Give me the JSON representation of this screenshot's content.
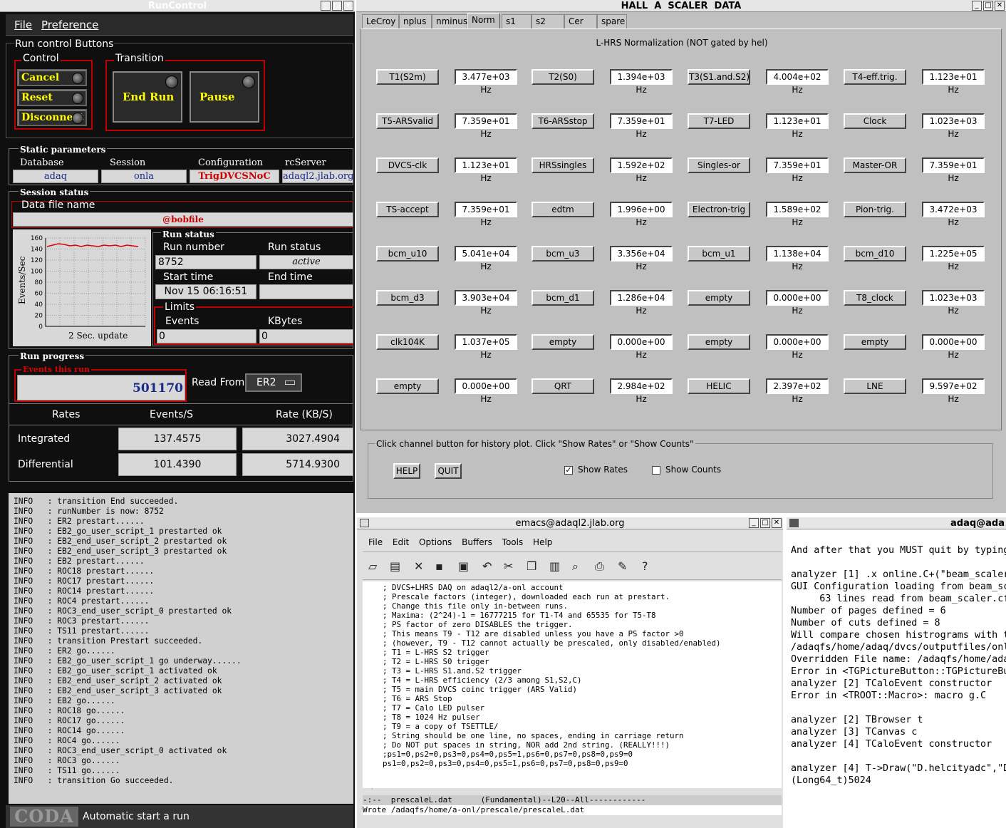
{
  "runcontrol": {
    "title": "RunControl",
    "menu": [
      "File",
      "Preference"
    ],
    "run_control_buttons": "Run control Buttons",
    "control_label": "Control",
    "control_buttons": [
      "Cancel",
      "Reset",
      "Disconnect"
    ],
    "transition_label": "Transition",
    "transition_buttons": [
      "End Run",
      "Pause"
    ],
    "static_parameters": "Static parameters",
    "static_headers": [
      "Database",
      "Session",
      "Configuration",
      "rcServer"
    ],
    "static_values": [
      "adaq",
      "onla",
      "TrigDVCSNoC",
      "adaql2.jlab.org"
    ],
    "session_status": "Session status",
    "data_file_name_label": "Data file name",
    "data_file_name": "@bobfile",
    "plot": {
      "ylabel": "Events/Sec",
      "xlabel": "2 Sec. update",
      "yticks": [
        "160",
        "140",
        "120",
        "100",
        "80",
        "60",
        "40",
        "20",
        "0"
      ]
    },
    "run_status_title": "Run status",
    "run_number_label": "Run number",
    "run_number": "8752",
    "run_status_label": "Run status",
    "run_status": "active",
    "start_time_label": "Start time",
    "start_time": "Nov 15 06:16:51",
    "end_time_label": "End time",
    "end_time": "",
    "limits_label": "Limits",
    "events_label": "Events",
    "events_limit": "0",
    "kbytes_label": "KBytes",
    "kbytes_limit": "0",
    "run_progress": "Run progress",
    "events_this_run_label": "Events this run",
    "events_this_run": "501170",
    "read_from_label": "Read From:",
    "read_from": "ER2",
    "rates_headers": [
      "Rates",
      "Events/S",
      "Rate (KB/S)"
    ],
    "rates_rows": [
      {
        "label": "Integrated",
        "events": "137.4575",
        "rate": "3027.4904"
      },
      {
        "label": "Differential",
        "events": "101.4390",
        "rate": "5714.9300"
      }
    ],
    "log": [
      "INFO   : transition End succeeded.",
      "INFO   : runNumber is now: 8752",
      "INFO   : ER2 prestart......",
      "INFO   : EB2_go_user_script_1 prestarted ok",
      "INFO   : EB2_end_user_script_2 prestarted ok",
      "INFO   : EB2_end_user_script_3 prestarted ok",
      "INFO   : EB2 prestart......",
      "INFO   : ROC18 prestart......",
      "INFO   : ROC17 prestart......",
      "INFO   : ROC14 prestart......",
      "INFO   : ROC4 prestart......",
      "INFO   : ROC3_end_user_script_0 prestarted ok",
      "INFO   : ROC3 prestart......",
      "INFO   : TS11 prestart......",
      "INFO   : transition Prestart succeeded.",
      "INFO   : ER2 go......",
      "INFO   : EB2_go_user_script_1 go underway......",
      "INFO   : EB2_go_user_script_1 activated ok",
      "INFO   : EB2_end_user_script_2 activated ok",
      "INFO   : EB2_end_user_script_3 activated ok",
      "INFO   : EB2 go......",
      "INFO   : ROC18 go......",
      "INFO   : ROC17 go......",
      "INFO   : ROC14 go......",
      "INFO   : ROC4 go......",
      "INFO   : ROC3_end_user_script_0 activated ok",
      "INFO   : ROC3 go......",
      "INFO   : TS11 go......",
      "INFO   : transition Go succeeded."
    ],
    "coda_logo": "CODA",
    "status_message": "Automatic start a run"
  },
  "scaler": {
    "title": "HALL  A  SCALER  DATA",
    "tabs": [
      "LeCroy",
      "nplus",
      "nminus",
      "Norm",
      "s1",
      "s2",
      "Cer",
      "spare"
    ],
    "active_tab": "Norm",
    "heading": "L-HRS Normalization (NOT gated by hel)",
    "rows": [
      [
        [
          "T1(S2m)",
          "3.477e+03 Hz"
        ],
        [
          "T2(S0)",
          "1.394e+03 Hz"
        ],
        [
          "T3(S1.and.S2)",
          "4.004e+02 Hz"
        ],
        [
          "T4-eff.trig.",
          "1.123e+01 Hz"
        ]
      ],
      [
        [
          "T5-ARSvalid",
          "7.359e+01 Hz"
        ],
        [
          "T6-ARSstop",
          "7.359e+01 Hz"
        ],
        [
          "T7-LED",
          "1.123e+01 Hz"
        ],
        [
          "Clock",
          "1.023e+03 Hz"
        ]
      ],
      [
        [
          "DVCS-clk",
          "1.123e+01 Hz"
        ],
        [
          "HRSsingles",
          "1.592e+02 Hz"
        ],
        [
          "Singles-or",
          "7.359e+01 Hz"
        ],
        [
          "Master-OR",
          "7.359e+01 Hz"
        ]
      ],
      [
        [
          "TS-accept",
          "7.359e+01 Hz"
        ],
        [
          "edtm",
          "1.996e+00 Hz"
        ],
        [
          "Electron-trig",
          "1.589e+02 Hz"
        ],
        [
          "Pion-trig.",
          "3.472e+03 Hz"
        ]
      ],
      [
        [
          "bcm_u10",
          "5.041e+04 Hz"
        ],
        [
          "bcm_u3",
          "3.356e+04 Hz"
        ],
        [
          "bcm_u1",
          "1.138e+04 Hz"
        ],
        [
          "bcm_d10",
          "1.225e+05 Hz"
        ]
      ],
      [
        [
          "bcm_d3",
          "3.903e+04 Hz"
        ],
        [
          "bcm_d1",
          "1.286e+04 Hz"
        ],
        [
          "empty",
          "0.000e+00 Hz"
        ],
        [
          "T8_clock",
          "1.023e+03 Hz"
        ]
      ],
      [
        [
          "clk104K",
          "1.037e+05 Hz"
        ],
        [
          "empty",
          "0.000e+00 Hz"
        ],
        [
          "empty",
          "0.000e+00 Hz"
        ],
        [
          "empty",
          "0.000e+00 Hz"
        ]
      ],
      [
        [
          "empty",
          "0.000e+00 Hz"
        ],
        [
          "QRT",
          "2.984e+02 Hz"
        ],
        [
          "HELIC",
          "2.397e+02 Hz"
        ],
        [
          "LNE",
          "9.597e+02 Hz"
        ]
      ]
    ],
    "instructions": "Click channel button for history plot.  Click \"Show Rates\" or \"Show Counts\"",
    "help_button": "HELP",
    "quit_button": "QUIT",
    "show_rates": "Show Rates",
    "show_counts": "Show Counts"
  },
  "emacs": {
    "title": "emacs@adaql2.jlab.org",
    "menu": [
      "File",
      "Edit",
      "Options",
      "Buffers",
      "Tools",
      "Help"
    ],
    "lines": [
      "; DVCS+LHRS DAQ on adaql2/a-onl account",
      "; Prescale factors (integer), downloaded each run at prestart.",
      "; Change this file only in-between runs.",
      "; Maxima: (2^24)-1 = 16777215 for T1-T4 and 65535 for T5-T8",
      "; PS factor of zero DISABLES the trigger.",
      "; This means T9 - T12 are disabled unless you have a PS factor >0",
      "; (however, T9 - T12 cannot actually be prescaled, only disabled/enabled)",
      "; T1 = L-HRS S2 trigger",
      "; T2 = L-HRS S0 trigger",
      "; T3 = L-HRS S1.and.S2 trigger",
      "; T4 = L-HRS efficiency (2/3 among S1,S2,C)",
      "; T5 = main DVCS coinc trigger (ARS Valid)",
      "; T6 = ARS Stop",
      "; T7 = Calo LED pulser",
      "; T8 = 1024 Hz pulser",
      "; T9 = a copy of TSETTLE/",
      "; String should be one line, no spaces, ending in carriage return",
      "; Do NOT put spaces in string, NOR add 2nd string. (REALLY!!!)",
      ";ps1=0,ps2=0,ps3=0,ps4=0,ps5=1,ps6=0,ps7=0,ps8=0,ps9=0",
      "ps1=0,ps2=0,ps3=0,ps4=0,ps5=1,ps6=0,ps7=0,ps8=0,ps9=0"
    ],
    "modeline": "-:--  prescaleL.dat      (Fundamental)--L20--All------------",
    "minibuffer": "Wrote /adaqfs/home/a-onl/prescale/prescaleL.dat"
  },
  "terminal": {
    "title": "adaq@ada",
    "lines": [
      "And after that you MUST quit by typing",
      "",
      "analyzer [1] .x online.C+(\"beam_scaler",
      "GUI Configuration loading from beam_sc",
      "     63 lines read from beam_scaler.cf",
      "Number of pages defined = 6",
      "Number of cuts defined = 8",
      "Will compare chosen histrograms with t",
      "/adaqfs/home/adaq/dvcs/outputfiles/onl",
      "Overridden File name: /adaqfs/home/ada",
      "Error in <TGPictureButton::TGPictureBu",
      "analyzer [2] TCaloEvent constructor",
      "Error in <TROOT::Macro>: macro g.C",
      "",
      "analyzer [2] TBrowser t",
      "analyzer [3] TCanvas c",
      "analyzer [4] TCaloEvent constructor",
      "",
      "analyzer [4] T->Draw(\"D.helcityadc\",\"D",
      "(Long64_t)5024"
    ]
  }
}
